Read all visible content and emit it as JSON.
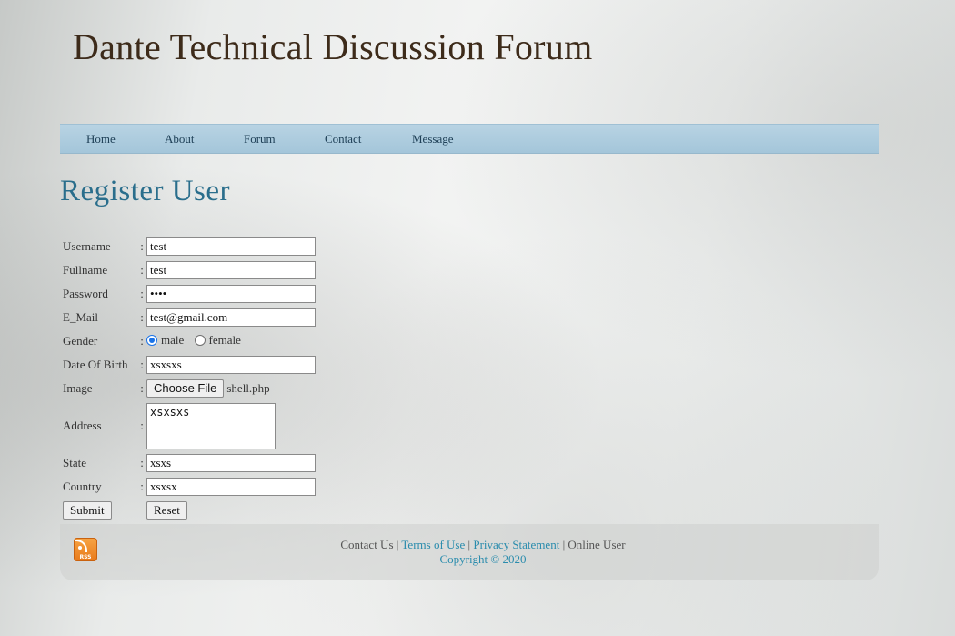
{
  "site": {
    "title": "Dante Technical Discussion Forum"
  },
  "nav": {
    "items": [
      "Home",
      "About",
      "Forum",
      "Contact",
      "Message"
    ]
  },
  "page": {
    "heading": "Register User"
  },
  "form": {
    "colon": ":",
    "username": {
      "label": "Username",
      "value": "test"
    },
    "fullname": {
      "label": "Fullname",
      "value": "test"
    },
    "password": {
      "label": "Password",
      "value": "test"
    },
    "email": {
      "label": "E_Mail",
      "value": "test@gmail.com"
    },
    "gender": {
      "label": "Gender",
      "options": [
        "male",
        "female"
      ],
      "selected": "male"
    },
    "dob": {
      "label": "Date Of Birth",
      "value": "xsxsxs"
    },
    "image": {
      "label": "Image",
      "button_label": "Choose File",
      "file_name": "shell.php"
    },
    "address": {
      "label": "Address",
      "value": "xsxsxs"
    },
    "state": {
      "label": "State",
      "value": "xsxs"
    },
    "country": {
      "label": "Country",
      "value": "xsxsx"
    },
    "submit_label": "Submit",
    "reset_label": "Reset"
  },
  "footer": {
    "contact": "Contact Us",
    "sep": "|",
    "terms": "Terms of Use",
    "privacy": "Privacy Statement",
    "online": "Online User",
    "copyright": "Copyright © 2020",
    "rss_label": "RSS"
  },
  "colors": {
    "accent": "#2a6e8c",
    "nav_bg": "#a9c9dc",
    "title": "#3d2b1a",
    "link": "#2a8cad"
  }
}
